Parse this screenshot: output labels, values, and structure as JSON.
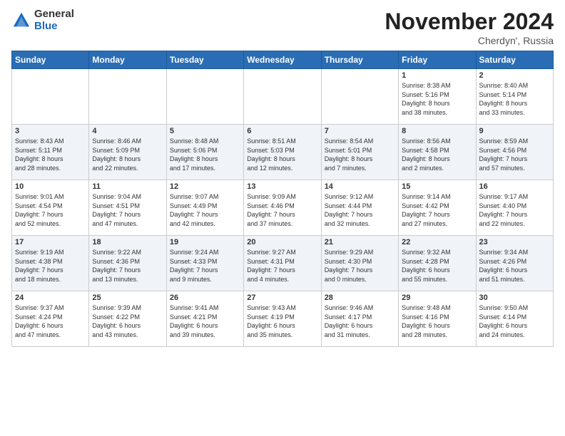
{
  "logo": {
    "general": "General",
    "blue": "Blue"
  },
  "title": "November 2024",
  "subtitle": "Cherdyn', Russia",
  "headers": [
    "Sunday",
    "Monday",
    "Tuesday",
    "Wednesday",
    "Thursday",
    "Friday",
    "Saturday"
  ],
  "weeks": [
    [
      {
        "day": "",
        "info": ""
      },
      {
        "day": "",
        "info": ""
      },
      {
        "day": "",
        "info": ""
      },
      {
        "day": "",
        "info": ""
      },
      {
        "day": "",
        "info": ""
      },
      {
        "day": "1",
        "info": "Sunrise: 8:38 AM\nSunset: 5:16 PM\nDaylight: 8 hours\nand 38 minutes."
      },
      {
        "day": "2",
        "info": "Sunrise: 8:40 AM\nSunset: 5:14 PM\nDaylight: 8 hours\nand 33 minutes."
      }
    ],
    [
      {
        "day": "3",
        "info": "Sunrise: 8:43 AM\nSunset: 5:11 PM\nDaylight: 8 hours\nand 28 minutes."
      },
      {
        "day": "4",
        "info": "Sunrise: 8:46 AM\nSunset: 5:09 PM\nDaylight: 8 hours\nand 22 minutes."
      },
      {
        "day": "5",
        "info": "Sunrise: 8:48 AM\nSunset: 5:06 PM\nDaylight: 8 hours\nand 17 minutes."
      },
      {
        "day": "6",
        "info": "Sunrise: 8:51 AM\nSunset: 5:03 PM\nDaylight: 8 hours\nand 12 minutes."
      },
      {
        "day": "7",
        "info": "Sunrise: 8:54 AM\nSunset: 5:01 PM\nDaylight: 8 hours\nand 7 minutes."
      },
      {
        "day": "8",
        "info": "Sunrise: 8:56 AM\nSunset: 4:58 PM\nDaylight: 8 hours\nand 2 minutes."
      },
      {
        "day": "9",
        "info": "Sunrise: 8:59 AM\nSunset: 4:56 PM\nDaylight: 7 hours\nand 57 minutes."
      }
    ],
    [
      {
        "day": "10",
        "info": "Sunrise: 9:01 AM\nSunset: 4:54 PM\nDaylight: 7 hours\nand 52 minutes."
      },
      {
        "day": "11",
        "info": "Sunrise: 9:04 AM\nSunset: 4:51 PM\nDaylight: 7 hours\nand 47 minutes."
      },
      {
        "day": "12",
        "info": "Sunrise: 9:07 AM\nSunset: 4:49 PM\nDaylight: 7 hours\nand 42 minutes."
      },
      {
        "day": "13",
        "info": "Sunrise: 9:09 AM\nSunset: 4:46 PM\nDaylight: 7 hours\nand 37 minutes."
      },
      {
        "day": "14",
        "info": "Sunrise: 9:12 AM\nSunset: 4:44 PM\nDaylight: 7 hours\nand 32 minutes."
      },
      {
        "day": "15",
        "info": "Sunrise: 9:14 AM\nSunset: 4:42 PM\nDaylight: 7 hours\nand 27 minutes."
      },
      {
        "day": "16",
        "info": "Sunrise: 9:17 AM\nSunset: 4:40 PM\nDaylight: 7 hours\nand 22 minutes."
      }
    ],
    [
      {
        "day": "17",
        "info": "Sunrise: 9:19 AM\nSunset: 4:38 PM\nDaylight: 7 hours\nand 18 minutes."
      },
      {
        "day": "18",
        "info": "Sunrise: 9:22 AM\nSunset: 4:36 PM\nDaylight: 7 hours\nand 13 minutes."
      },
      {
        "day": "19",
        "info": "Sunrise: 9:24 AM\nSunset: 4:33 PM\nDaylight: 7 hours\nand 9 minutes."
      },
      {
        "day": "20",
        "info": "Sunrise: 9:27 AM\nSunset: 4:31 PM\nDaylight: 7 hours\nand 4 minutes."
      },
      {
        "day": "21",
        "info": "Sunrise: 9:29 AM\nSunset: 4:30 PM\nDaylight: 7 hours\nand 0 minutes."
      },
      {
        "day": "22",
        "info": "Sunrise: 9:32 AM\nSunset: 4:28 PM\nDaylight: 6 hours\nand 55 minutes."
      },
      {
        "day": "23",
        "info": "Sunrise: 9:34 AM\nSunset: 4:26 PM\nDaylight: 6 hours\nand 51 minutes."
      }
    ],
    [
      {
        "day": "24",
        "info": "Sunrise: 9:37 AM\nSunset: 4:24 PM\nDaylight: 6 hours\nand 47 minutes."
      },
      {
        "day": "25",
        "info": "Sunrise: 9:39 AM\nSunset: 4:22 PM\nDaylight: 6 hours\nand 43 minutes."
      },
      {
        "day": "26",
        "info": "Sunrise: 9:41 AM\nSunset: 4:21 PM\nDaylight: 6 hours\nand 39 minutes."
      },
      {
        "day": "27",
        "info": "Sunrise: 9:43 AM\nSunset: 4:19 PM\nDaylight: 6 hours\nand 35 minutes."
      },
      {
        "day": "28",
        "info": "Sunrise: 9:46 AM\nSunset: 4:17 PM\nDaylight: 6 hours\nand 31 minutes."
      },
      {
        "day": "29",
        "info": "Sunrise: 9:48 AM\nSunset: 4:16 PM\nDaylight: 6 hours\nand 28 minutes."
      },
      {
        "day": "30",
        "info": "Sunrise: 9:50 AM\nSunset: 4:14 PM\nDaylight: 6 hours\nand 24 minutes."
      }
    ]
  ]
}
